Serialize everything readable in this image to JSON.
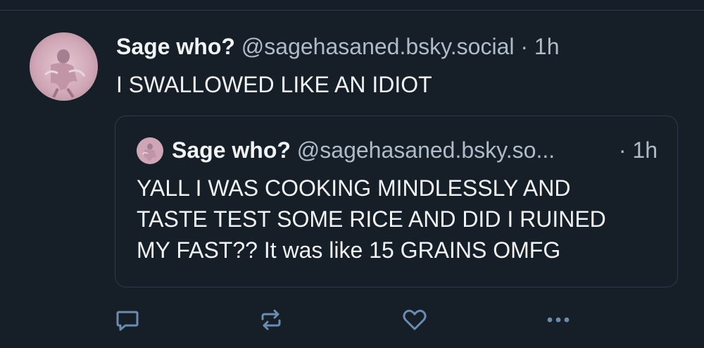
{
  "post": {
    "author_name": "Sage who?",
    "author_handle": "@sagehasaned.bsky.social",
    "separator": "·",
    "time": "1h",
    "text": "I SWALLOWED LIKE AN IDIOT"
  },
  "quote": {
    "author_name": "Sage who?",
    "author_handle": "@sagehasaned.bsky.so...",
    "separator": "·",
    "time": "1h",
    "text_lines": [
      "YALL I WAS COOKING MINDLESSLY AND",
      "TASTE TEST SOME RICE AND DID I RUINED",
      "MY FAST?? It was like 15 GRAINS OMFG"
    ]
  },
  "actions": [
    {
      "icon": "reply-icon"
    },
    {
      "icon": "repost-icon"
    },
    {
      "icon": "like-icon"
    },
    {
      "icon": "more-icon"
    }
  ],
  "colors": {
    "background": "#161e27",
    "text": "#f1f3f5",
    "muted": "#aebbc9",
    "border": "#2e3a48",
    "icon": "#6b8bb0"
  }
}
